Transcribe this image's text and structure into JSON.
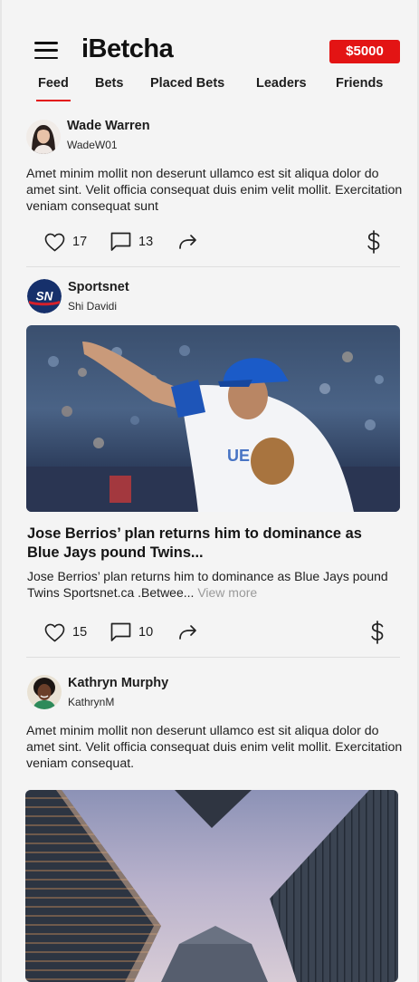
{
  "app": {
    "title": "iBetcha",
    "balance": "$5000"
  },
  "tabs": [
    {
      "label": "Feed",
      "active": true
    },
    {
      "label": "Bets"
    },
    {
      "label": "Placed Bets"
    },
    {
      "label": "Leaders"
    },
    {
      "label": "Friends"
    }
  ],
  "posts": [
    {
      "author": "Wade Warren",
      "handle": "WadeW01",
      "text": "Amet minim mollit non deserunt ullamco est sit aliqua dolor do amet sint. Velit officia consequat duis enim velit mollit. Exercitation veniam consequat sunt",
      "likes": "17",
      "comments": "13"
    },
    {
      "author": "Sportsnet",
      "handle": "Shi Davidi",
      "logo_text": "SN",
      "headline": "Jose Berrios’ plan returns him to dominance as Blue Jays pound Twins...",
      "summary": "Jose Berrios’ plan returns him to dominance as Blue Jays pound Twins  Sportsnet.ca .Betwee...",
      "view_more": "View more",
      "likes": "15",
      "comments": "10"
    },
    {
      "author": "Kathryn Murphy",
      "handle": "KathrynM",
      "text": "Amet minim mollit non deserunt ullamco est sit aliqua dolor do amet sint. Velit officia consequat duis enim velit mollit. Exercitation veniam consequat."
    }
  ],
  "colors": {
    "accent": "#e31414",
    "sportsnet_blue": "#16306b"
  }
}
